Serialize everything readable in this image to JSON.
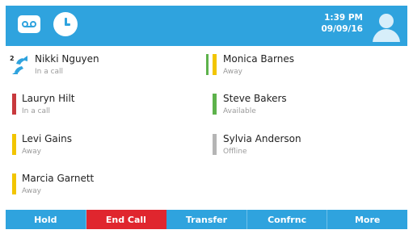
{
  "header": {
    "time": "1:39 PM",
    "date": "09/09/16",
    "icons": [
      "voicemail-icon",
      "recent-calls-icon",
      "user-avatar-icon"
    ],
    "background_color": "#2fa3de"
  },
  "contacts": [
    {
      "name": "Nikki Nguyen",
      "status": "In a call",
      "state": "in-call",
      "color": "#2fa3de",
      "icon": "call-transfer-icon"
    },
    {
      "name": "Monica Barnes",
      "status": "Away",
      "state": "away",
      "color": "#f2c500"
    },
    {
      "name": "Lauryn Hilt",
      "status": "In a call",
      "state": "busy",
      "color": "#c8393d"
    },
    {
      "name": "Steve Bakers",
      "status": "Available",
      "state": "available",
      "color": "#5db24b"
    },
    {
      "name": "Levi Gains",
      "status": "Away",
      "state": "away",
      "color": "#f2c500"
    },
    {
      "name": "Sylvia Anderson",
      "status": "Offline",
      "state": "offline",
      "color": "#b5b5b5"
    },
    {
      "name": "Marcia Garnett",
      "status": "Away",
      "state": "away",
      "color": "#f2c500"
    }
  ],
  "softkeys": [
    {
      "label": "Hold"
    },
    {
      "label": "End Call",
      "color": "#e0262e"
    },
    {
      "label": "Transfer"
    },
    {
      "label": "Confrnc"
    },
    {
      "label": "More"
    }
  ]
}
